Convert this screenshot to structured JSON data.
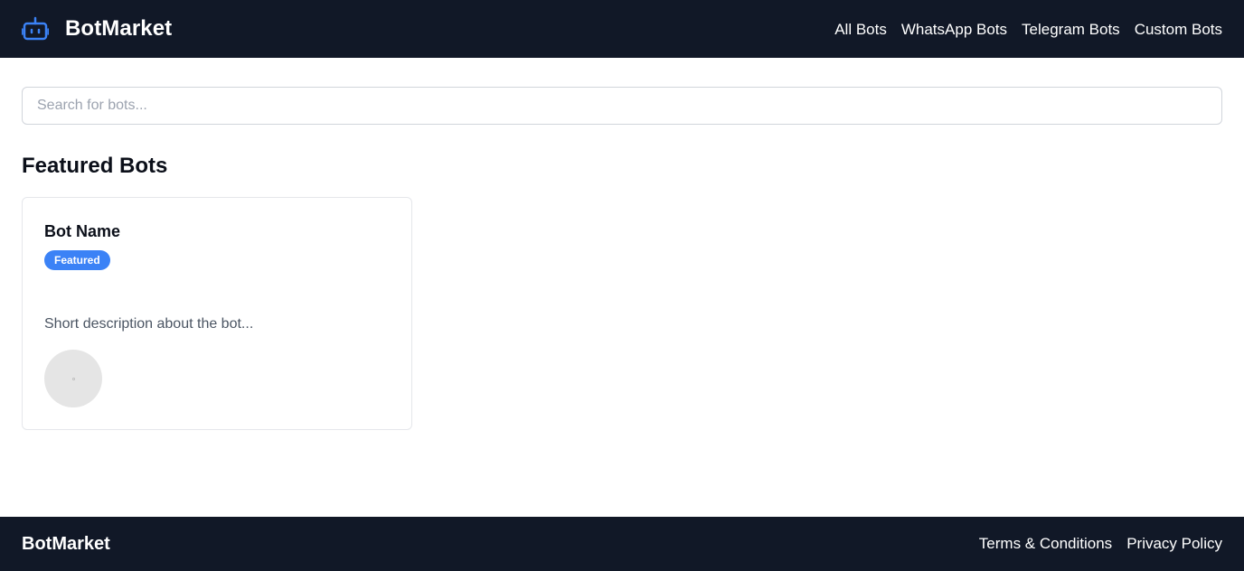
{
  "header": {
    "brand_name": "BotMarket",
    "brand_icon": "robot-icon",
    "nav": [
      {
        "label": "All Bots"
      },
      {
        "label": "WhatsApp Bots"
      },
      {
        "label": "Telegram Bots"
      },
      {
        "label": "Custom Bots"
      }
    ]
  },
  "search": {
    "placeholder": "Search for bots...",
    "value": ""
  },
  "featured": {
    "title": "Featured Bots",
    "cards": [
      {
        "name": "Bot Name",
        "badge": "Featured",
        "description": "Short description about the bot..."
      }
    ]
  },
  "footer": {
    "brand_name": "BotMarket",
    "links": [
      {
        "label": "Terms & Conditions"
      },
      {
        "label": "Privacy Policy"
      }
    ]
  },
  "colors": {
    "header_bg": "#111827",
    "accent": "#3b82f6",
    "badge_bg": "#3b82f6",
    "footer_bg": "#111827"
  }
}
